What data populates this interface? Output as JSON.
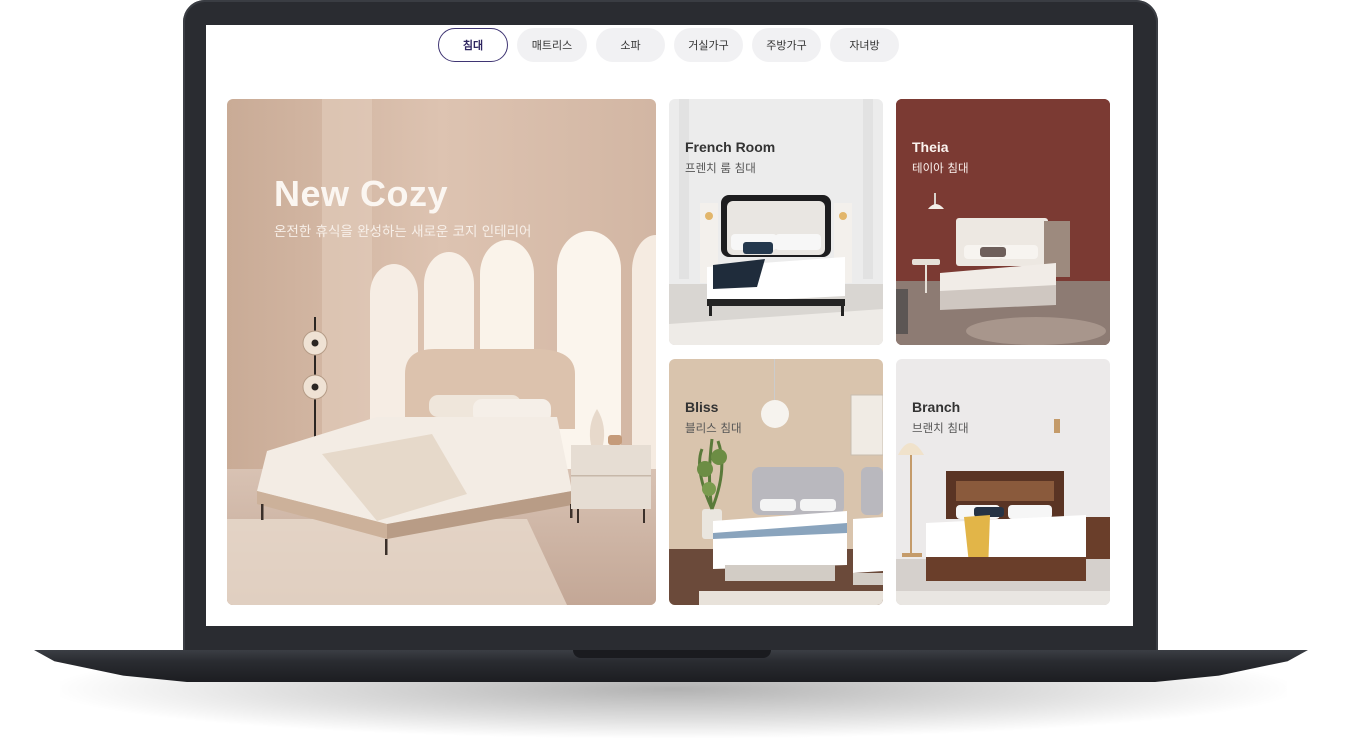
{
  "tabs": [
    {
      "label": "침대",
      "active": true
    },
    {
      "label": "매트리스",
      "active": false
    },
    {
      "label": "소파",
      "active": false
    },
    {
      "label": "거실가구",
      "active": false
    },
    {
      "label": "주방가구",
      "active": false
    },
    {
      "label": "자녀방",
      "active": false
    }
  ],
  "hero": {
    "title": "New Cozy",
    "subtitle": "온전한 휴식을 완성하는 새로운 코지 인테리어"
  },
  "products": [
    {
      "title": "French Room",
      "subtitle": "프렌치 룸 침대"
    },
    {
      "title": "Theia",
      "subtitle": "테이아 침대"
    },
    {
      "title": "Bliss",
      "subtitle": "블리스 침대"
    },
    {
      "title": "Branch",
      "subtitle": "브랜치 침대"
    }
  ],
  "colors": {
    "accent": "#3f3573",
    "tab_bg": "#f1f1f3",
    "frame": "#2a2c31"
  }
}
